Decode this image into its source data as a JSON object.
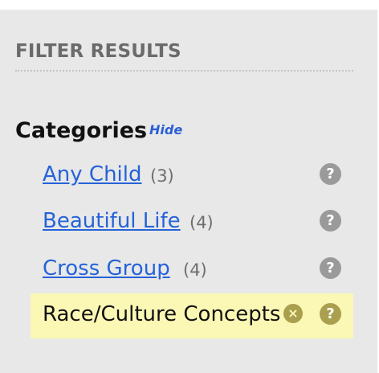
{
  "filter": {
    "title": "FILTER RESULTS",
    "categories_heading": "Categories",
    "hide_label": "Hide",
    "items": [
      {
        "label": "Any Child",
        "count": "(3)"
      },
      {
        "label": "Beautiful Life",
        "count": "(4)"
      },
      {
        "label": "Cross Group",
        "count": "(4)"
      },
      {
        "label": "Race/Culture Concepts",
        "selected": true
      }
    ],
    "help_glyph": "?",
    "remove_glyph": "×"
  }
}
